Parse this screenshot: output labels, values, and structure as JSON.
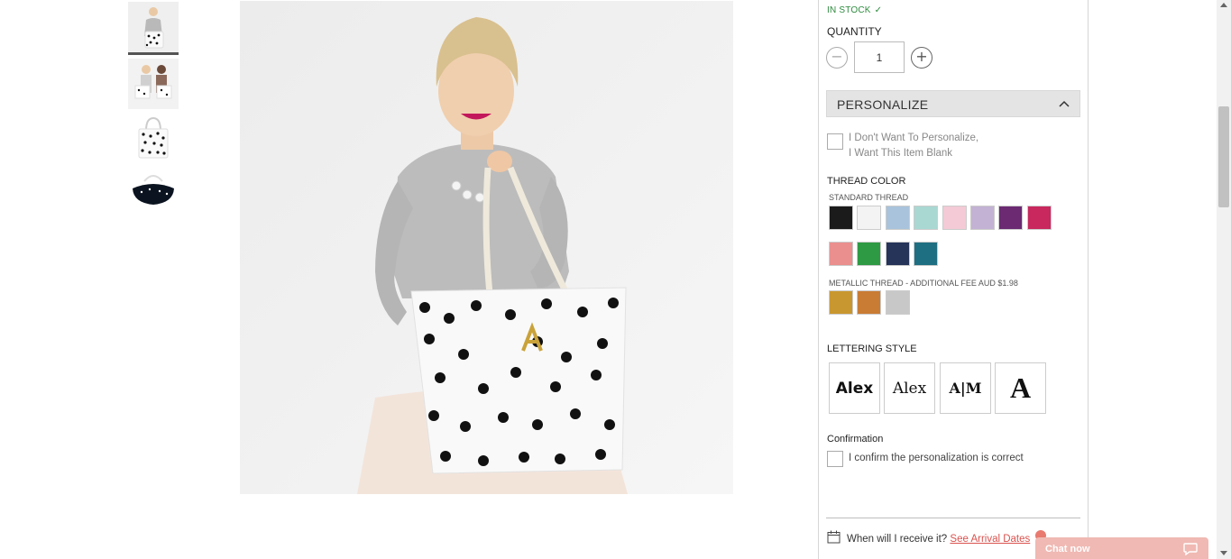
{
  "stock": {
    "text": "IN STOCK",
    "check": "✓",
    "color": "#2e8b3e"
  },
  "quantity": {
    "label": "QUANTITY",
    "value": "1",
    "minus": "−",
    "plus": "+"
  },
  "personalize": {
    "title": "PERSONALIZE",
    "expanded": true
  },
  "blank_option": {
    "line1": "I Don't Want To Personalize,",
    "line2": "I Want This Item Blank",
    "checked": false
  },
  "thread_color": {
    "label": "THREAD COLOR",
    "standard_label": "STANDARD THREAD",
    "standard": [
      {
        "name": "black",
        "color": "#1b1b1b"
      },
      {
        "name": "white",
        "color": "#f3f3f3"
      },
      {
        "name": "light-blue",
        "color": "#a9c3dc"
      },
      {
        "name": "mint",
        "color": "#a9d8d2"
      },
      {
        "name": "light-pink",
        "color": "#f3cad6"
      },
      {
        "name": "lavender",
        "color": "#c3b2d4"
      },
      {
        "name": "purple",
        "color": "#6b2a72"
      },
      {
        "name": "raspberry",
        "color": "#c8285e"
      },
      {
        "name": "coral",
        "color": "#ea8f8d"
      },
      {
        "name": "green",
        "color": "#2f9a44"
      },
      {
        "name": "navy",
        "color": "#26345a"
      },
      {
        "name": "teal",
        "color": "#1f6f82"
      }
    ],
    "metallic_label": "METALLIC THREAD - ADDITIONAL FEE AUD $1.98",
    "metallic": [
      {
        "name": "gold",
        "color": "#c9972f"
      },
      {
        "name": "copper",
        "color": "#c97c34"
      },
      {
        "name": "silver",
        "color": "#c8c8c8"
      }
    ]
  },
  "lettering": {
    "label": "LETTERING STYLE",
    "options": [
      "Alex",
      "Alex",
      "A|M",
      "A"
    ]
  },
  "confirmation": {
    "label": "Confirmation",
    "text": "I confirm the personalization is correct",
    "checked": false
  },
  "arrival": {
    "question": "When will I receive it?",
    "link": "See Arrival Dates"
  },
  "chat": {
    "label": "Chat now",
    "color": "#f0b9b3"
  }
}
